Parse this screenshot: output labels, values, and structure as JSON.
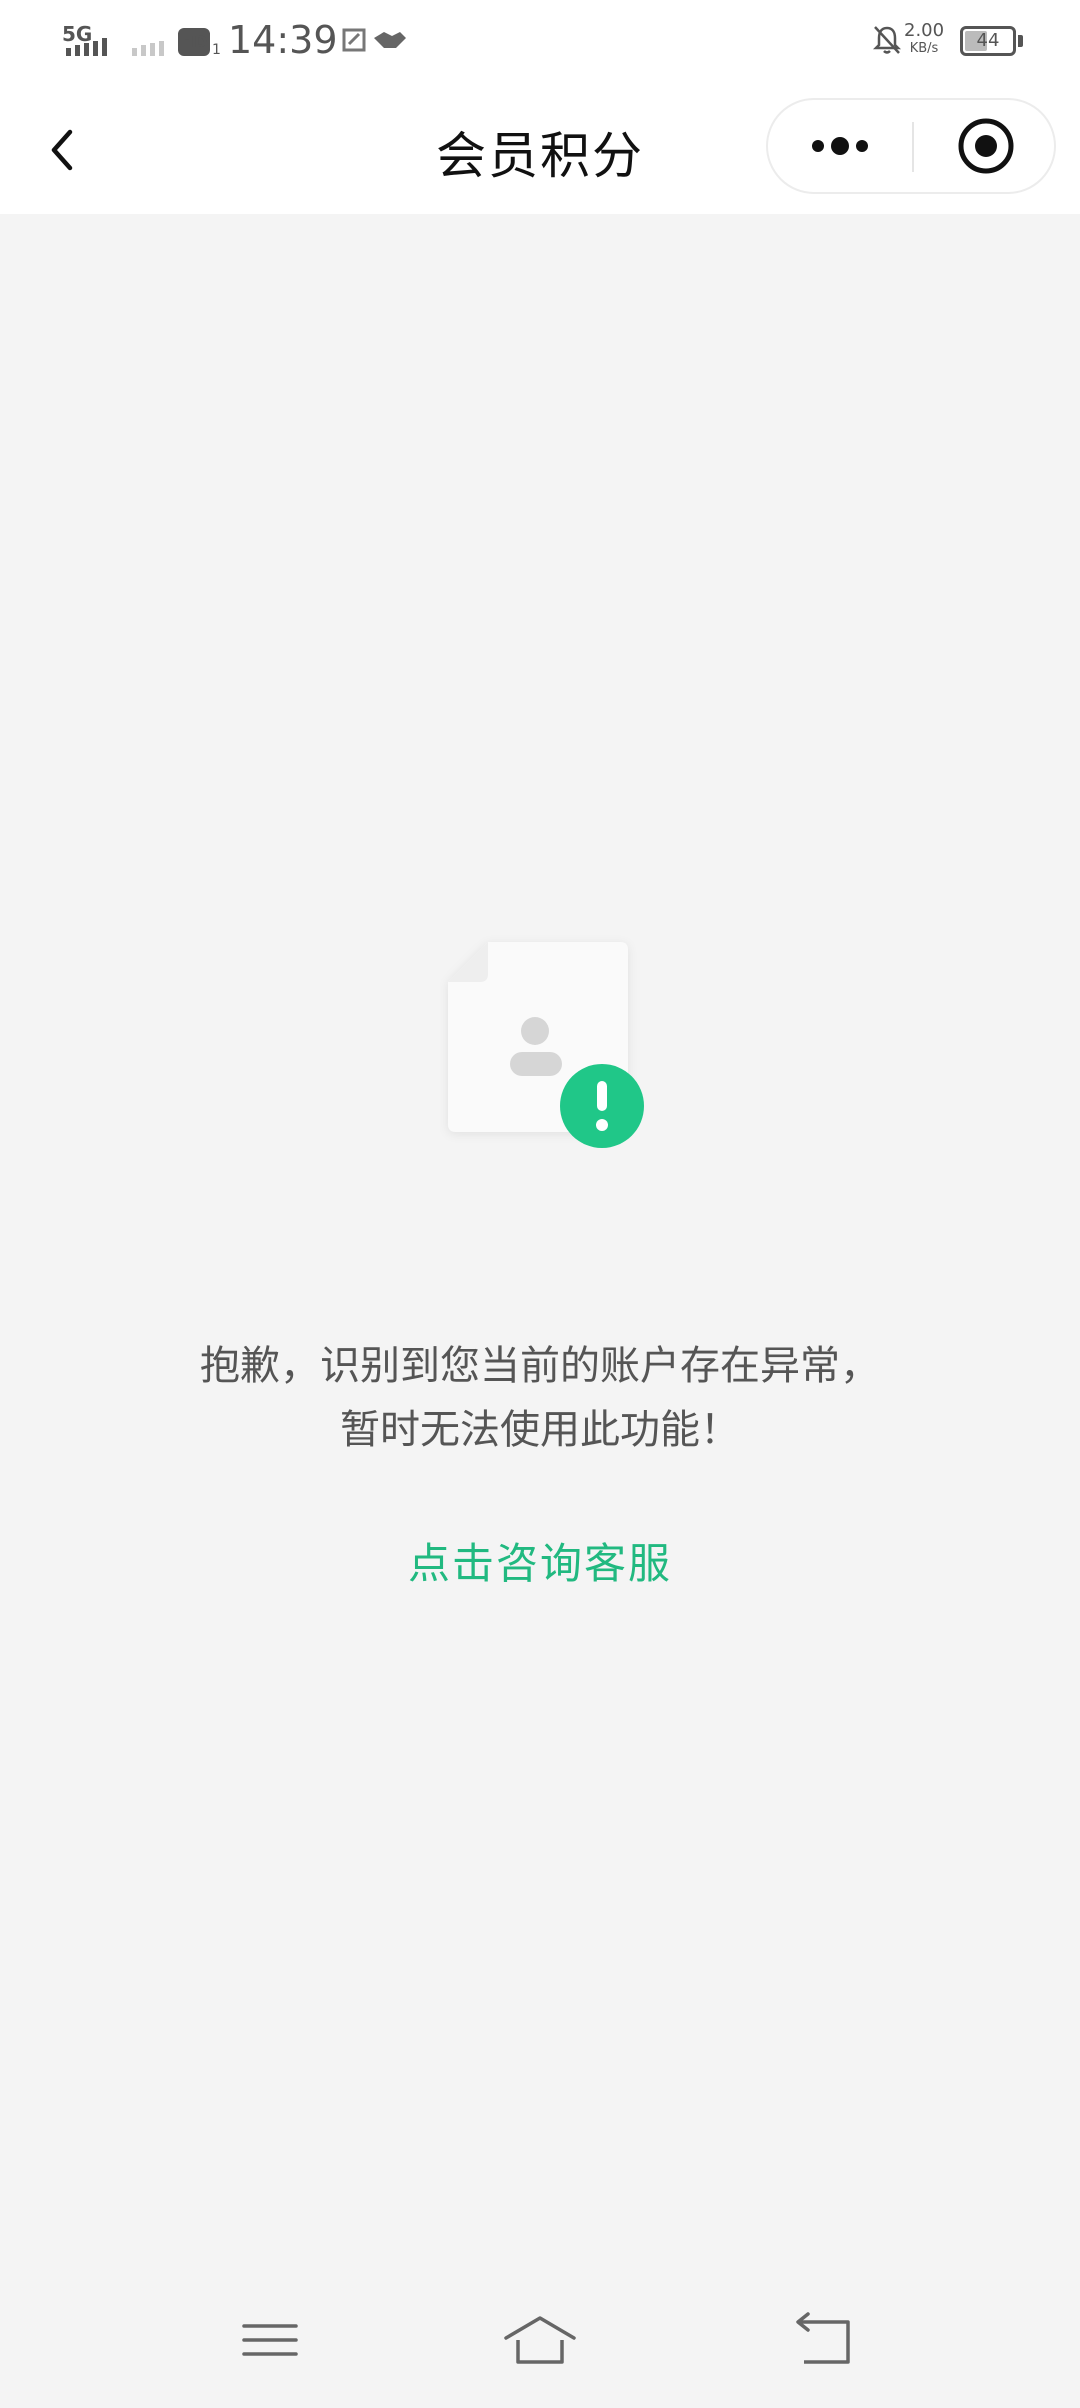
{
  "status_bar": {
    "network": "5G",
    "hd_label": "HD",
    "hd_sub": "1",
    "time": "14:39",
    "speed_value": "2.00",
    "speed_unit": "KB/s",
    "battery": "44",
    "icons": [
      "signal-bars-icon",
      "signal-bars-icon",
      "screenshot-icon",
      "handshake-icon",
      "bell-off-icon",
      "battery-icon"
    ]
  },
  "nav": {
    "title": "会员积分",
    "icons": [
      "back-chevron-icon",
      "more-dots-icon",
      "close-target-icon"
    ]
  },
  "main": {
    "message_line1": "抱歉，识别到您当前的账户存在异常，",
    "message_line2": "暂时无法使用此功能！",
    "link_label": "点击咨询客服",
    "illustration_icon": "account-warning-icon",
    "accent_color": "#21b980"
  },
  "system_nav": {
    "icons": [
      "menu-icon",
      "home-icon",
      "back-icon"
    ]
  }
}
